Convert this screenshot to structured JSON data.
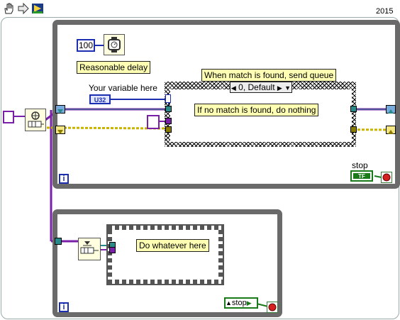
{
  "version": "2015",
  "toolbar": {
    "icons": [
      "hand-icon",
      "arrow-icon",
      "run-arrow-icon"
    ]
  },
  "top_loop": {
    "delay": {
      "constant": "100",
      "label": "Reasonable delay"
    },
    "variable": {
      "label": "Your variable here",
      "type": "U32"
    },
    "case_structure": {
      "title": "When match is found, send queue",
      "selector": "0, Default",
      "comment": "If no match is found, do nothing"
    },
    "stop": {
      "label": "stop",
      "value": "TF"
    },
    "iteration": "i"
  },
  "bottom_loop": {
    "comment": "Do whatever here",
    "stop_local": "stop",
    "iteration": "i"
  },
  "colors": {
    "queue_wire": "#7a1fa8",
    "data_wire": "#2a8a8a",
    "error_wire": "#c8b400",
    "loop_border": "#6a6a6a",
    "label_bg": "#ffffb4"
  }
}
